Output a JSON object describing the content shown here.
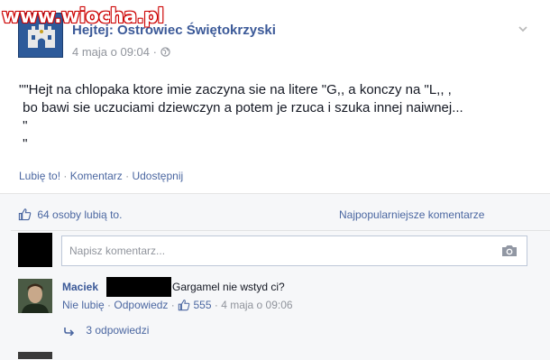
{
  "watermark": "www.wiocha.pl",
  "post": {
    "page_name": "Hejtej: Ostrowiec Świętokrzyski",
    "date": "4 maja o 09:04",
    "globe_icon": "globe-icon",
    "text_lines": [
      "\"\"Hejt na chlopaka ktore imie zaczyna sie na litere \"G,, a konczy na \"L,, ,",
      " bo bawi sie uczuciami dziewczyn a potem je rzuca i szuka innej naiwnej...",
      " \"",
      " \""
    ],
    "actions": {
      "like": "Lubię to!",
      "comment": "Komentarz",
      "share": "Udostępnij",
      "separator": "·"
    }
  },
  "likes": {
    "count_text": "64 osoby lubią to.",
    "sort_label": "Najpopularniejsze komentarze"
  },
  "comment_input": {
    "placeholder": "Napisz komentarz..."
  },
  "comment": {
    "author": "Maciek",
    "text": "Gargamel nie wstyd ci?",
    "unlike": "Nie lubię",
    "reply": "Odpowiedz",
    "like_count": "555",
    "date": "4 maja o 09:06",
    "replies": "3 odpowiedzi"
  },
  "colors": {
    "link": "#4b67a1",
    "name": "#3b5998",
    "muted": "#90949c",
    "panel": "#f6f7f9"
  }
}
